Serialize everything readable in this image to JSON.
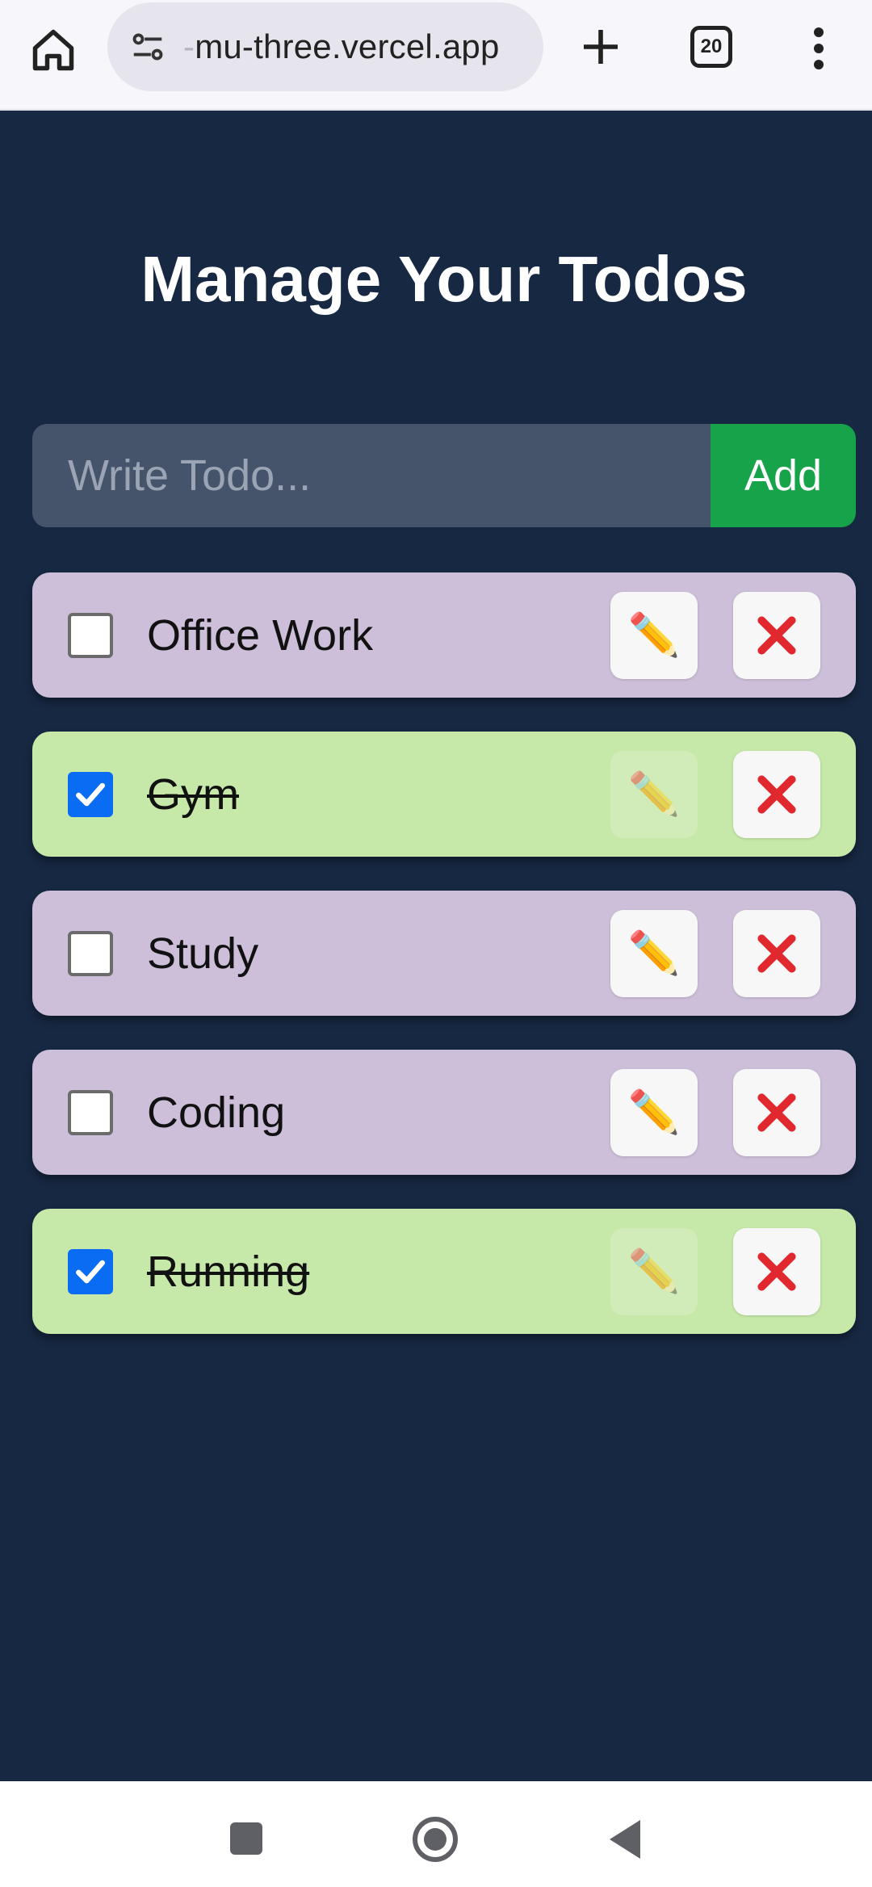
{
  "browser": {
    "url_prefix": "-",
    "url": "mu-three.vercel.app",
    "tab_count": "20"
  },
  "page": {
    "title": "Manage Your Todos"
  },
  "form": {
    "input_placeholder": "Write Todo...",
    "input_value": "",
    "add_label": "Add"
  },
  "todos": [
    {
      "text": "Office Work",
      "completed": false,
      "edit_icon": "✏️",
      "delete_icon": "❌"
    },
    {
      "text": "Gym",
      "completed": true,
      "edit_icon": "✏️",
      "delete_icon": "❌"
    },
    {
      "text": "Study",
      "completed": false,
      "edit_icon": "✏️",
      "delete_icon": "❌"
    },
    {
      "text": "Coding",
      "completed": false,
      "edit_icon": "✏️",
      "delete_icon": "❌"
    },
    {
      "text": "Running",
      "completed": true,
      "edit_icon": "✏️",
      "delete_icon": "❌"
    }
  ],
  "colors": {
    "background": "#172842",
    "pending_item": "#cdbfd9",
    "completed_item": "#c6e8a8",
    "add_button": "#16a34a",
    "checkbox_checked": "#0a6cf2"
  },
  "icons": {
    "home": "home-icon",
    "site_settings": "tune-icon",
    "new_tab": "plus-icon",
    "tabs": "tab-switcher-icon",
    "menu": "more-vert-icon",
    "edit": "pencil-icon",
    "delete": "cross-icon"
  }
}
